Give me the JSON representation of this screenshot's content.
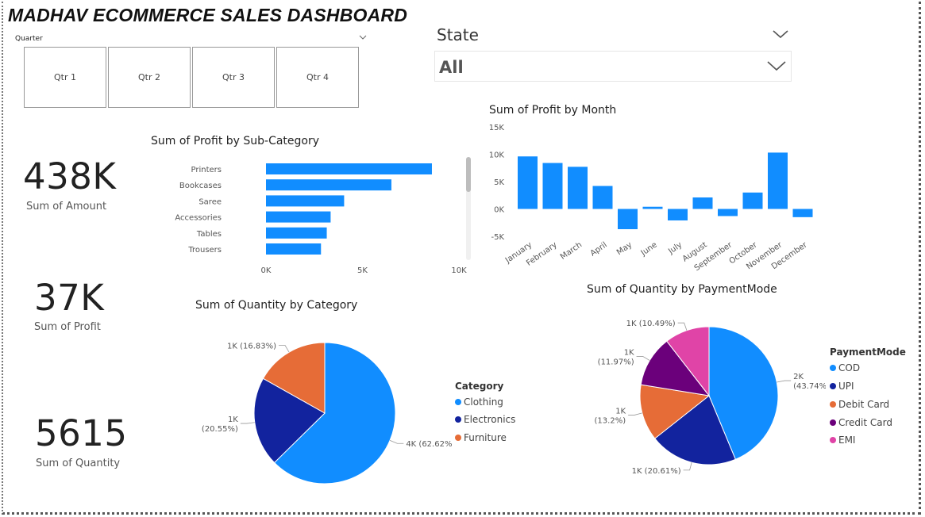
{
  "header": {
    "title": "MADHAV ECOMMERCE SALES DASHBOARD"
  },
  "quarter_slicer": {
    "label": "Quarter",
    "options": [
      "Qtr 1",
      "Qtr 2",
      "Qtr 3",
      "Qtr 4"
    ]
  },
  "state_slicer": {
    "label": "State",
    "selected": "All"
  },
  "kpis": {
    "amount": {
      "value": "438K",
      "label": "Sum of Amount"
    },
    "profit": {
      "value": "37K",
      "label": "Sum of Profit"
    },
    "quantity": {
      "value": "5615",
      "label": "Sum of Quantity"
    }
  },
  "icons": {
    "slicer_dropdown": "chevron-down-icon",
    "state_dropdown": "chevron-down-icon"
  },
  "colors": {
    "bar": "#118DFF",
    "clothing": "#118DFF",
    "electronics": "#12239E",
    "furniture": "#E66C37",
    "cod": "#118DFF",
    "upi": "#12239E",
    "debit": "#E66C37",
    "credit": "#6B007B",
    "emi": "#E044A7"
  },
  "chart_data": [
    {
      "type": "bar",
      "orientation": "horizontal",
      "title": "Sum of Profit by Sub-Category",
      "categories": [
        "Printers",
        "Bookcases",
        "Saree",
        "Accessories",
        "Tables",
        "Trousers"
      ],
      "values": [
        8600,
        6500,
        4050,
        3350,
        3150,
        2850
      ],
      "xlim": [
        0,
        10000
      ],
      "ticks": [
        "0K",
        "5K",
        "10K"
      ]
    },
    {
      "type": "bar",
      "title": "Sum of Profit by Month",
      "categories": [
        "January",
        "February",
        "March",
        "April",
        "May",
        "June",
        "July",
        "August",
        "September",
        "October",
        "November",
        "December"
      ],
      "values": [
        9600,
        8400,
        7700,
        4200,
        -3700,
        400,
        -2100,
        2100,
        -1300,
        3000,
        10300,
        -1500
      ],
      "ylim": [
        -5000,
        15000
      ],
      "ticks": [
        "-5K",
        "0K",
        "5K",
        "10K",
        "15K"
      ]
    },
    {
      "type": "pie",
      "title": "Sum of Quantity by Category",
      "legend_title": "Category",
      "slices": [
        {
          "name": "Clothing",
          "percent": 62.62,
          "label": "4K (62.62%)"
        },
        {
          "name": "Electronics",
          "percent": 20.55,
          "label_line1": "1K",
          "label_line2": "(20.55%)"
        },
        {
          "name": "Furniture",
          "percent": 16.83,
          "label": "1K (16.83%)"
        }
      ]
    },
    {
      "type": "pie",
      "title": "Sum of Quantity by PaymentMode",
      "legend_title": "PaymentMode",
      "slices": [
        {
          "name": "COD",
          "percent": 43.74,
          "label_line1": "2K",
          "label_line2": "(43.74%)"
        },
        {
          "name": "UPI",
          "percent": 20.61,
          "label": "1K (20.61%)"
        },
        {
          "name": "Debit Card",
          "percent": 13.2,
          "label_line1": "1K",
          "label_line2": "(13.2%)"
        },
        {
          "name": "Credit Card",
          "percent": 11.97,
          "label_line1": "1K",
          "label_line2": "(11.97%)"
        },
        {
          "name": "EMI",
          "percent": 10.49,
          "label": "1K (10.49%)"
        }
      ]
    }
  ]
}
